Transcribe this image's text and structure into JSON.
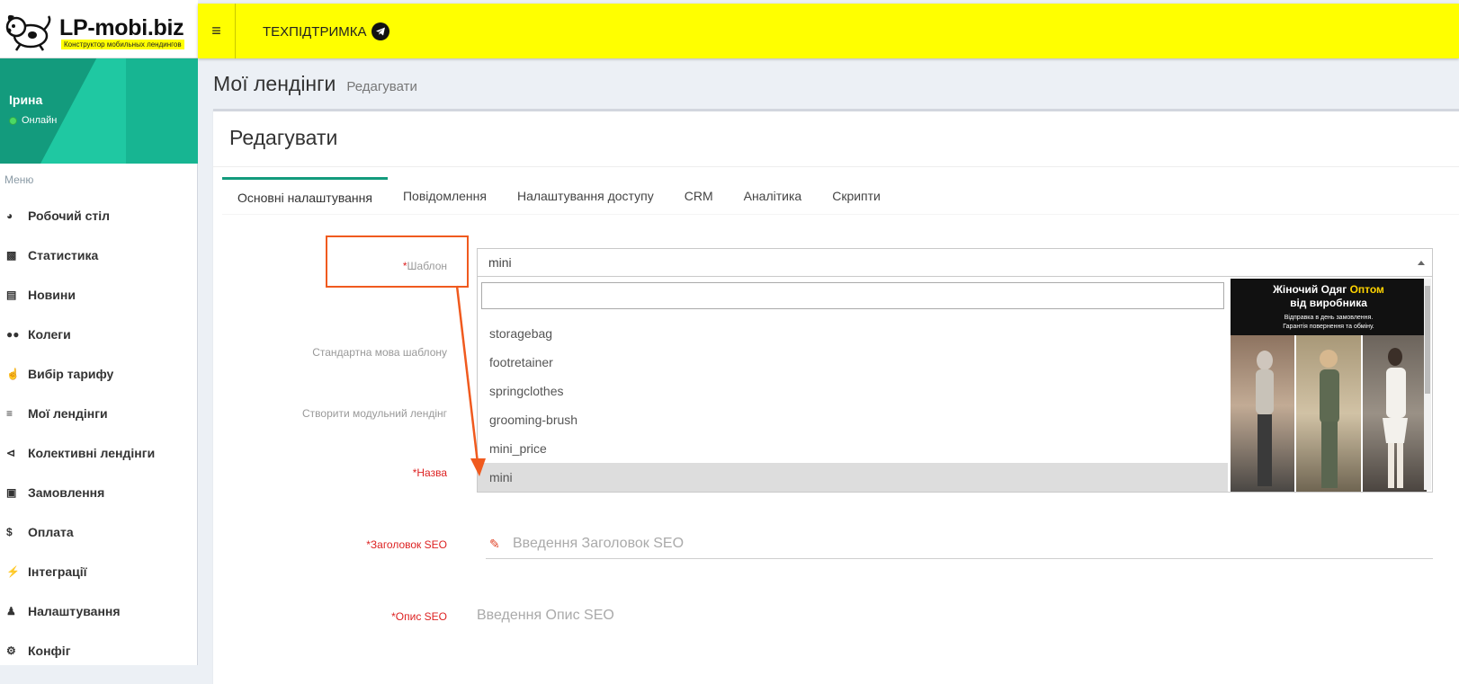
{
  "logo": {
    "title": "LP-mobi.biz",
    "subtitle": "Конструктор мобильных лендингов"
  },
  "topbar": {
    "menu_icon": "hamburger-icon",
    "support_label": "ТЕХПІДТРИМКА",
    "support_icon": "telegram-icon"
  },
  "user": {
    "name": "Ірина",
    "status": "Онлайн"
  },
  "sidebar": {
    "menu_header": "Меню",
    "items": [
      {
        "label": "Робочий стіл",
        "icon": "dashboard-icon"
      },
      {
        "label": "Статистика",
        "icon": "bar-chart-icon"
      },
      {
        "label": "Новини",
        "icon": "newspaper-icon"
      },
      {
        "label": "Колеги",
        "icon": "users-icon"
      },
      {
        "label": "Вибір тарифу",
        "icon": "pointer-hand-icon"
      },
      {
        "label": "Мої лендінги",
        "icon": "stack-icon"
      },
      {
        "label": "Колективні лендінги",
        "icon": "share-icon"
      },
      {
        "label": "Замовлення",
        "icon": "cart-icon"
      },
      {
        "label": "Оплата",
        "icon": "dollar-icon"
      },
      {
        "label": "Інтеграції",
        "icon": "plug-icon"
      },
      {
        "label": "Налаштування",
        "icon": "user-icon"
      },
      {
        "label": "Конфіг",
        "icon": "cogs-icon"
      }
    ]
  },
  "content": {
    "title": "Мої лендінги",
    "subtitle": "Редагувати"
  },
  "box": {
    "title": "Редагувати"
  },
  "tabs": [
    "Основні налаштування",
    "Повідомлення",
    "Налаштування доступу",
    "CRM",
    "Аналітика",
    "Скрипти"
  ],
  "form": {
    "template_label": "Шаблон",
    "template_value": "mini",
    "lang_label": "Стандартна мова шаблону",
    "modular_label": "Створити модульний лендінг",
    "name_label": "Назва",
    "seo_title_label": "Заголовок SEO",
    "seo_title_placeholder": "Введення Заголовок SEO",
    "seo_desc_label": "Опис SEO",
    "seo_desc_placeholder": "Введення Опис SEO",
    "required_mark": "*"
  },
  "dropdown": {
    "options": [
      "storagebag",
      "footretainer",
      "springclothes",
      "grooming-brush",
      "mini_price",
      "mini"
    ],
    "selected": "mini"
  },
  "preview": {
    "line1": "Жіночий Одяг",
    "line1_accent": "Оптом",
    "line2": "від виробника",
    "line3": "Відправка в день замовлення.",
    "line4": "Гарантія повернення та обміну."
  },
  "colors": {
    "topbar": "#ffff00",
    "sidebar_panel": "#139b7d",
    "highlight": "#f05a1e",
    "required": "#dd2222"
  }
}
